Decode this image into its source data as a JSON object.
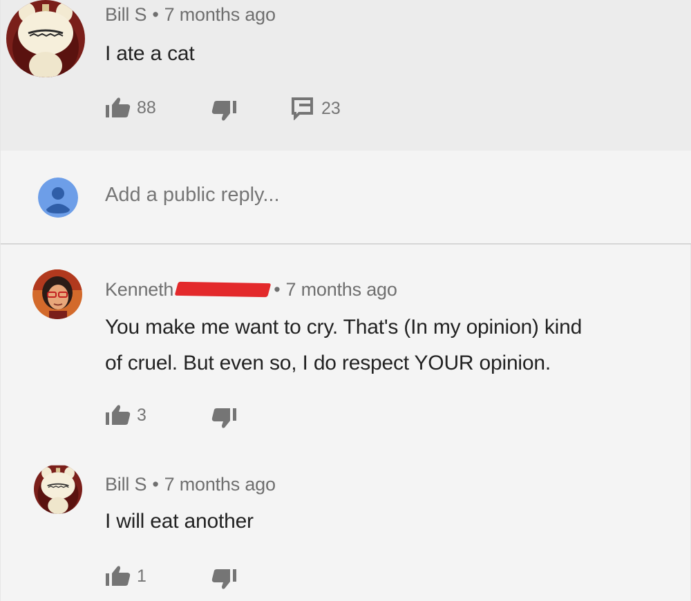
{
  "comment": {
    "author": "Bill S",
    "separator": "•",
    "time": "7 months ago",
    "text": "I ate a cat",
    "likes": "88",
    "replies": "23"
  },
  "reply_box": {
    "placeholder": "Add a public reply..."
  },
  "replies": [
    {
      "author": "Kenneth",
      "separator": "•",
      "time": "7 months ago",
      "text_line1": "You make me want to cry. That's (In my opinion) kind",
      "text_line2": "of cruel. But even so, I do respect YOUR opinion.",
      "likes": "3"
    },
    {
      "author": "Bill S",
      "separator": "•",
      "time": "7 months ago",
      "text": "I will eat another",
      "likes": "1"
    }
  ],
  "icons": {
    "like": "thumbs-up-icon",
    "dislike": "thumbs-down-icon",
    "reply": "comment-icon",
    "user": "user-avatar-icon"
  },
  "colors": {
    "highlight_bg": "#ececec",
    "page_bg": "#f4f4f4",
    "user_avatar": "#6d9ee8",
    "redaction": "#e3292b"
  }
}
